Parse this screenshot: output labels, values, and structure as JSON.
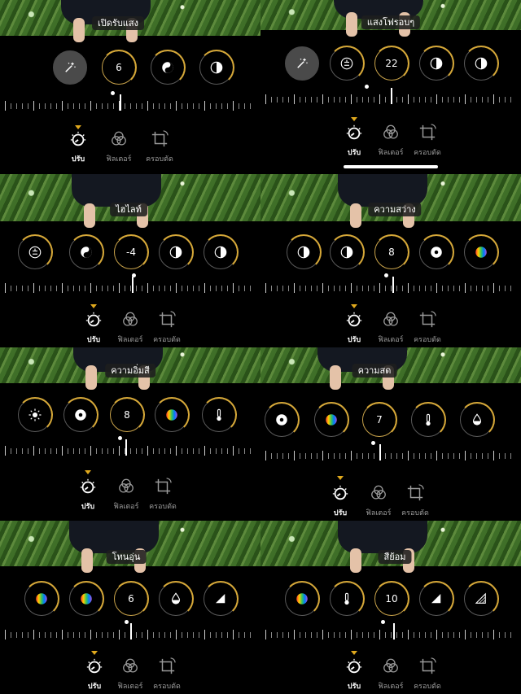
{
  "tab_labels": {
    "adjust": "ปรับ",
    "filters": "ฟิลเตอร์",
    "crop": "ครอบตัด"
  },
  "panels": [
    {
      "id": "auto",
      "label": "เปิดรับแสง",
      "tools": [
        {
          "icon": "magic-wand-icon",
          "kind": "wand"
        },
        {
          "value": "6",
          "kind": "num"
        },
        {
          "icon": "yin-yang-icon",
          "kind": "icon"
        },
        {
          "icon": "half-contrast-icon",
          "kind": "icon"
        }
      ]
    },
    {
      "id": "exposure",
      "label": "แสงโฟรอบๆ",
      "tools": [
        {
          "icon": "magic-wand-icon",
          "kind": "wand"
        },
        {
          "icon": "exposure-icon",
          "kind": "icon"
        },
        {
          "value": "22",
          "kind": "num"
        },
        {
          "icon": "half-contrast-icon",
          "kind": "icon"
        },
        {
          "icon": "half-contrast-icon",
          "kind": "icon"
        }
      ]
    },
    {
      "id": "highlights",
      "label": "ไฮไลท์",
      "tools": [
        {
          "icon": "exposure-icon",
          "kind": "icon"
        },
        {
          "icon": "yin-yang-icon",
          "kind": "icon"
        },
        {
          "value": "-4",
          "kind": "num"
        },
        {
          "icon": "half-contrast-icon",
          "kind": "icon"
        },
        {
          "icon": "half-contrast-icon",
          "kind": "icon"
        }
      ]
    },
    {
      "id": "brightness",
      "label": "ความสว่าง",
      "tools": [
        {
          "icon": "half-contrast-icon",
          "kind": "icon"
        },
        {
          "icon": "half-contrast-icon",
          "kind": "icon"
        },
        {
          "value": "8",
          "kind": "num"
        },
        {
          "icon": "target-icon",
          "kind": "icon"
        },
        {
          "icon": "color-wheel-icon",
          "kind": "icon"
        }
      ]
    },
    {
      "id": "saturation",
      "label": "ความอิ่มสี",
      "tools": [
        {
          "icon": "sun-icon",
          "kind": "icon"
        },
        {
          "icon": "target-icon",
          "kind": "icon"
        },
        {
          "value": "8",
          "kind": "num"
        },
        {
          "icon": "color-wheel-icon",
          "kind": "icon"
        },
        {
          "icon": "thermometer-icon",
          "kind": "icon"
        }
      ]
    },
    {
      "id": "vibrance",
      "label": "ความสด",
      "tools": [
        {
          "icon": "target-icon",
          "kind": "icon"
        },
        {
          "icon": "color-wheel-icon",
          "kind": "icon"
        },
        {
          "value": "7",
          "kind": "num"
        },
        {
          "icon": "thermometer-icon",
          "kind": "icon"
        },
        {
          "icon": "droplet-icon",
          "kind": "icon"
        }
      ]
    },
    {
      "id": "warmth",
      "label": "โทนอุ่น",
      "tools": [
        {
          "icon": "color-wheel-icon",
          "kind": "icon"
        },
        {
          "icon": "color-wheel-icon",
          "kind": "icon"
        },
        {
          "value": "6",
          "kind": "num"
        },
        {
          "icon": "droplet-icon",
          "kind": "icon"
        },
        {
          "icon": "sharpness-icon",
          "kind": "icon"
        }
      ]
    },
    {
      "id": "tint",
      "label": "สีย้อม",
      "tools": [
        {
          "icon": "color-wheel-icon",
          "kind": "icon"
        },
        {
          "icon": "thermometer-icon",
          "kind": "icon"
        },
        {
          "value": "10",
          "kind": "num"
        },
        {
          "icon": "sharpness-icon",
          "kind": "icon"
        },
        {
          "icon": "definition-icon",
          "kind": "icon"
        }
      ]
    }
  ]
}
